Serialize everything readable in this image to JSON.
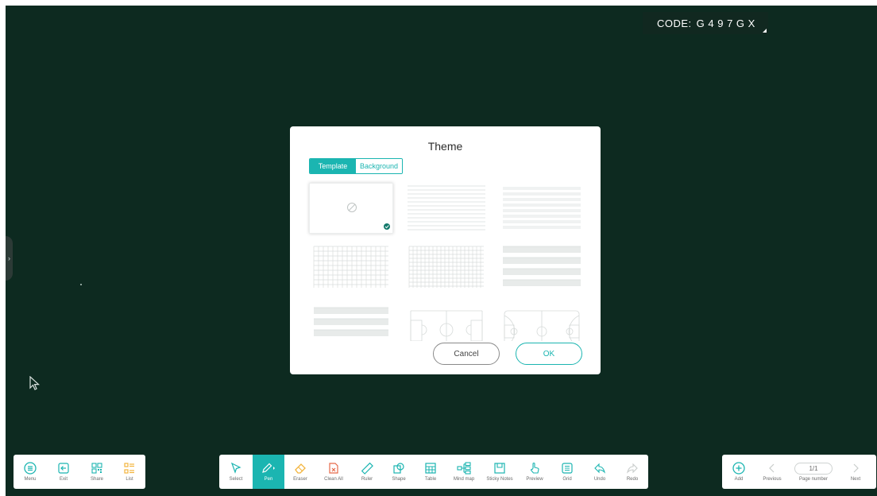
{
  "code_badge": {
    "label": "CODE:",
    "code": "G 4 9 7 G X"
  },
  "dialog": {
    "title": "Theme",
    "tabs": {
      "template": "Template",
      "background": "Background"
    },
    "templates": [
      "blank",
      "lines",
      "lines-dense",
      "grid",
      "grid-small",
      "music-staff",
      "music-staff-2",
      "soccer-field",
      "basketball-court"
    ],
    "selected_template": "blank",
    "buttons": {
      "cancel": "Cancel",
      "ok": "OK"
    }
  },
  "left_toolbar": {
    "menu": "Menu",
    "exit": "Exit",
    "share": "Share",
    "list": "List"
  },
  "center_toolbar": {
    "select": "Select",
    "pen": "Pen",
    "eraser": "Eraser",
    "clean_all": "Clean All",
    "ruler": "Ruler",
    "shape": "Shape",
    "table": "Table",
    "mind_map": "Mind map",
    "sticky_notes": "Sticky Notes",
    "preview": "Preview",
    "grid": "Grid",
    "undo": "Undo",
    "redo": "Redo"
  },
  "right_toolbar": {
    "add": "Add",
    "previous": "Previous",
    "page_number": "1/1",
    "page_number_label": "Page number",
    "next": "Next"
  },
  "colors": {
    "accent": "#1bb5b1",
    "canvas": "#0d2a20",
    "list_icon": "#f3b43c",
    "eraser_icon": "#f3b43c",
    "clean_all_icon": "#e66a4a"
  }
}
